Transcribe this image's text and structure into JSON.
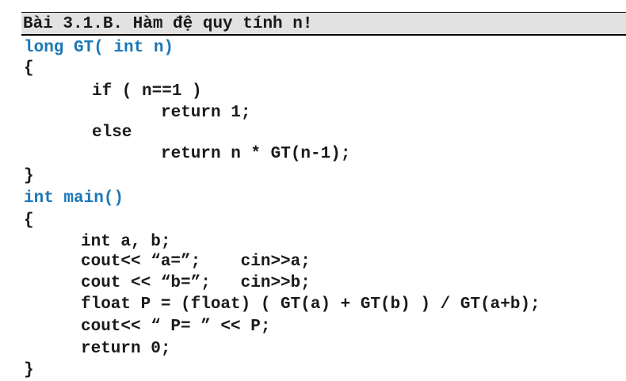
{
  "header": {
    "title": "Bài 3.1.B. Hàm đệ quy tính n!"
  },
  "colors": {
    "keyword_blue": "#1b77b8",
    "text": "#1a1a1a",
    "header_bg": "#e2e2e2"
  },
  "code": {
    "l01": "long GT( int n)",
    "l02": "{",
    "l03": "if ( n==1 )",
    "l04": "return 1;",
    "l05": "else",
    "l06": "return n * GT(n-1);",
    "l07": "}",
    "l08": "int main()",
    "l09": "{",
    "l10": "int a, b;",
    "l11": "cout<< “a=”;    cin>>a;",
    "l12": "cout << “b=”;   cin>>b;",
    "l13": "float P = (float) ( GT(a) + GT(b) ) / GT(a+b);",
    "l14": "cout<< “ P= ” << P;",
    "l15": "return 0;",
    "l16": "}"
  }
}
